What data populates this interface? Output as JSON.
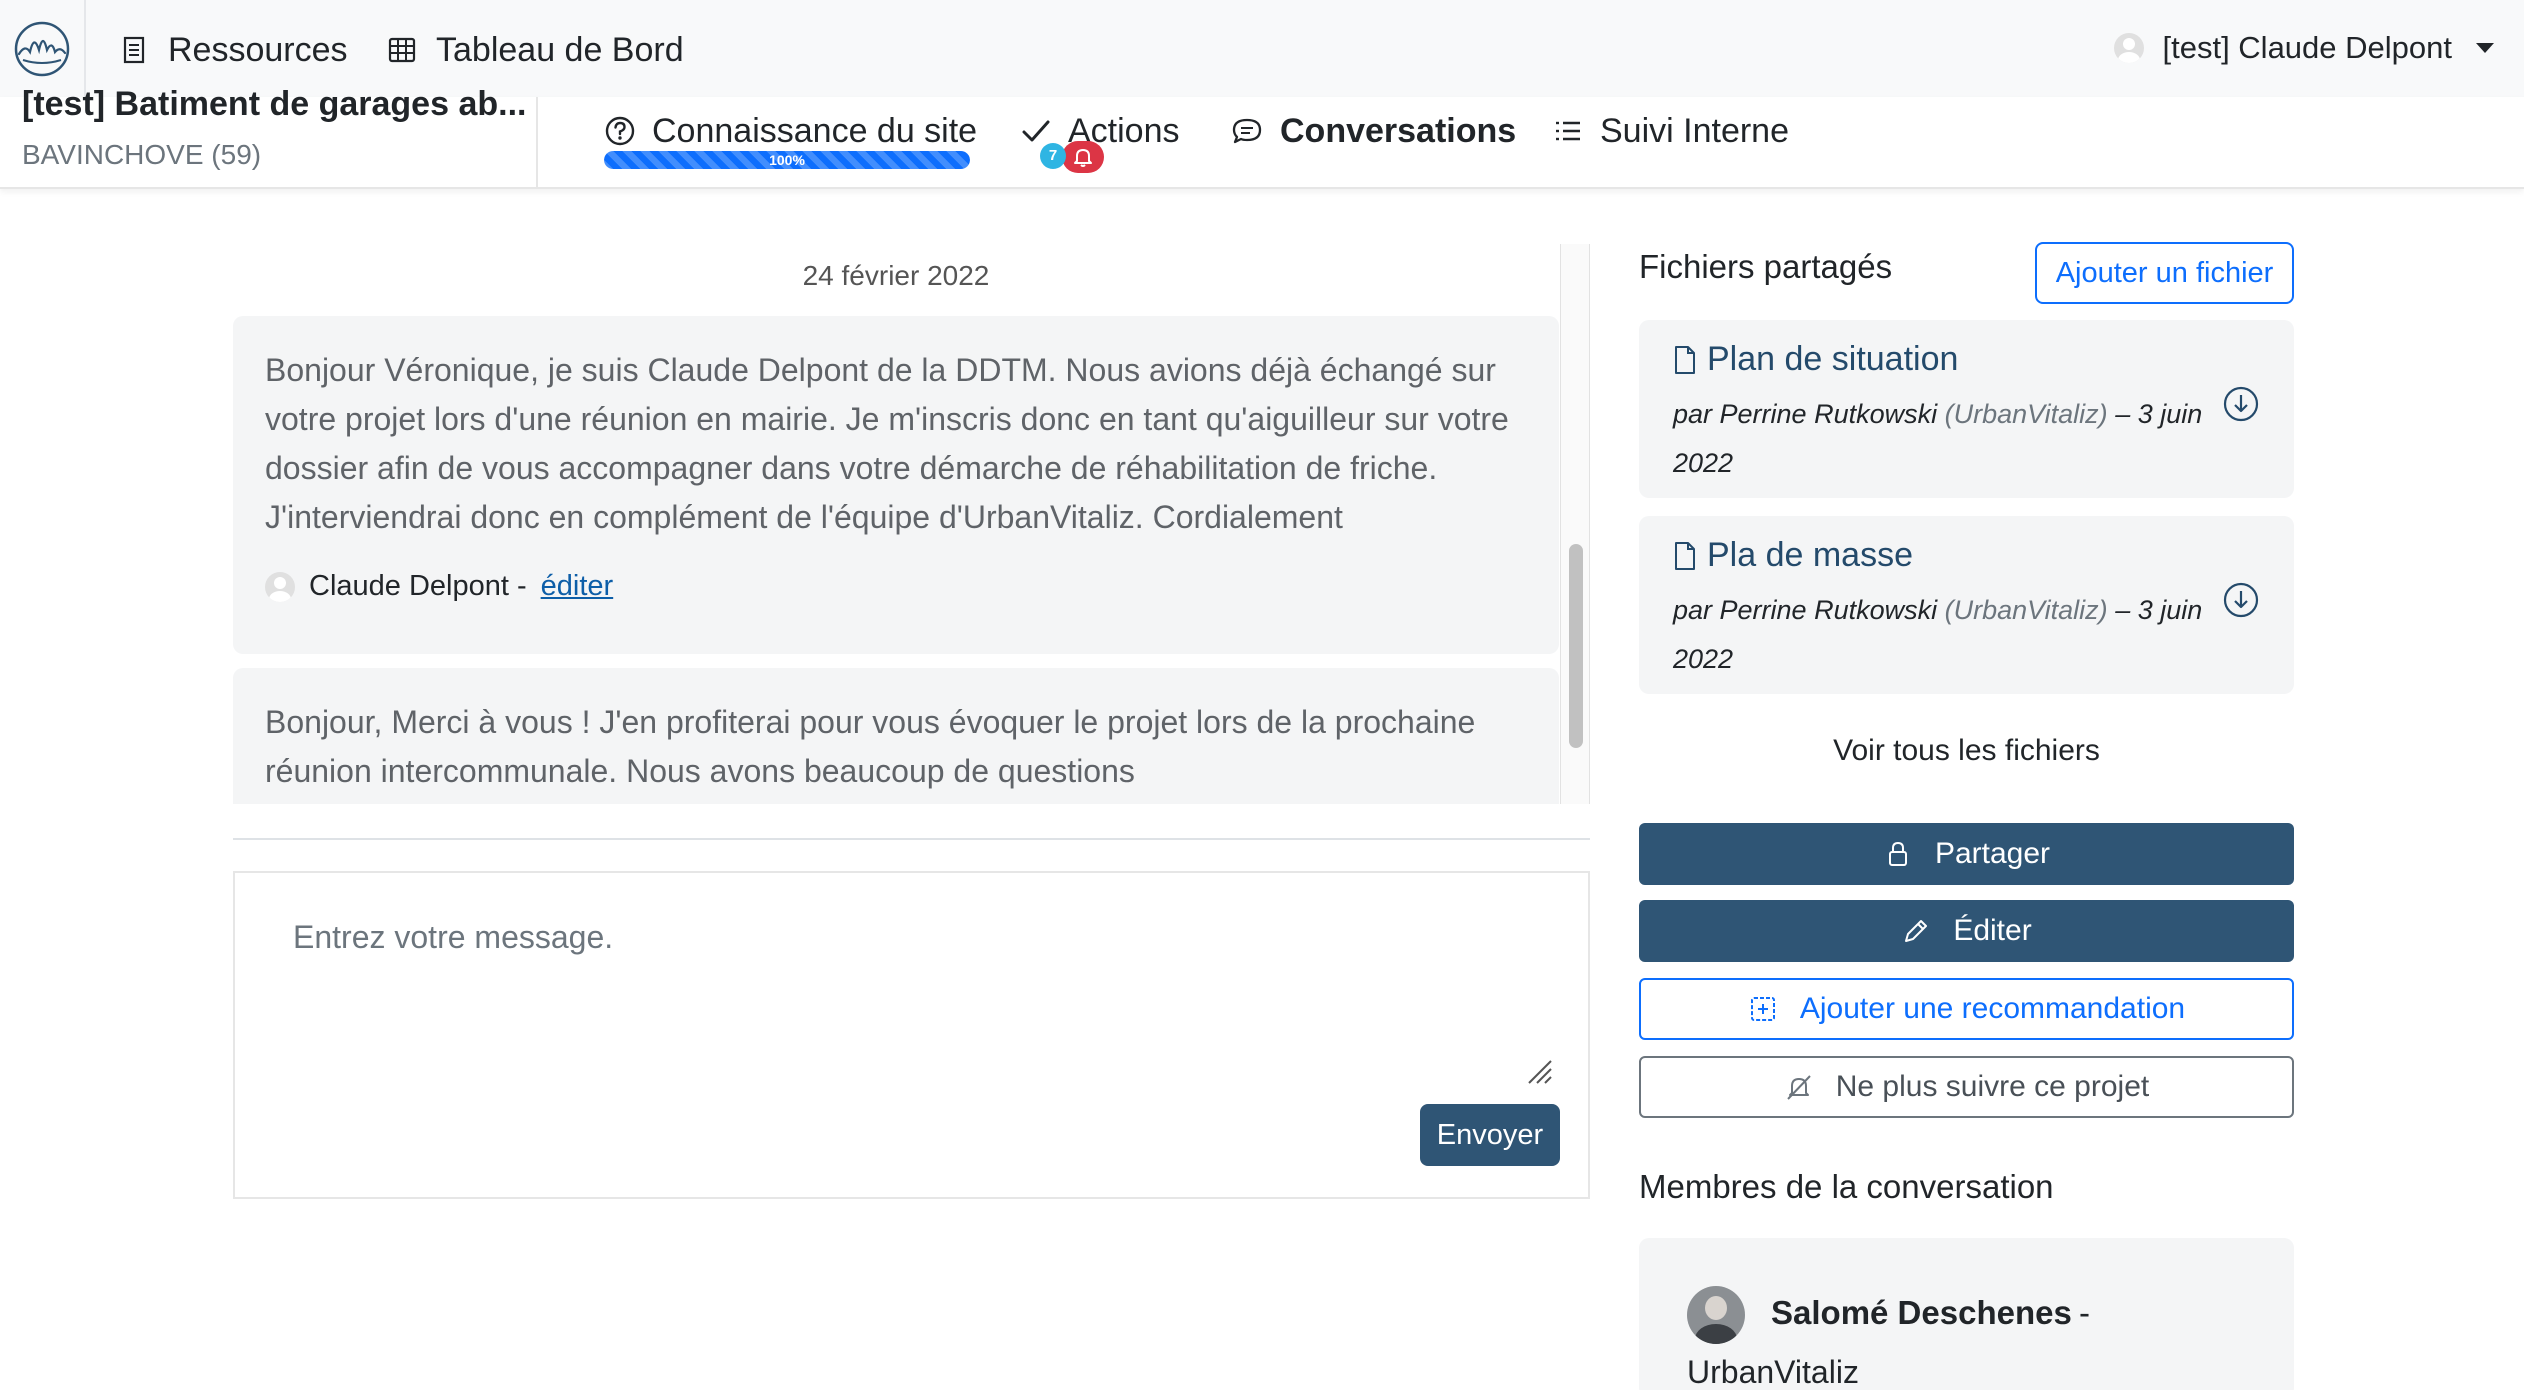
{
  "nav": {
    "resources_label": "Ressources",
    "dashboard_label": "Tableau de Bord",
    "user_label": "[test] Claude Delpont"
  },
  "project": {
    "title": "[test] Batiment de garages ab...",
    "location": "BAVINCHOVE (59)"
  },
  "tabs": {
    "knowledge_label": "Connaissance du site",
    "knowledge_progress_text": "100%",
    "knowledge_progress_value": 100,
    "actions_label": "Actions",
    "actions_badge_count": "7",
    "conversations_label": "Conversations",
    "internal_label": "Suivi Interne"
  },
  "conversation": {
    "date": "24 février 2022",
    "messages": [
      {
        "text": "Bonjour Véronique, je suis Claude Delpont de la DDTM. Nous avions déjà échangé sur votre projet lors d'une réunion en mairie. Je m'inscris donc en tant qu'aiguilleur sur votre dossier afin de vous accompagner dans votre démarche de réhabilitation de friche. J'interviendrai donc en complément de l'équipe d'UrbanVitaliz. Cordialement",
        "author": "Claude Delpont -",
        "edit_label": "éditer"
      },
      {
        "text": "Bonjour, Merci à vous ! J'en profiterai pour vous évoquer le projet lors de la prochaine réunion intercommunale. Nous avons beaucoup de questions"
      }
    ],
    "composer_placeholder": "Entrez votre message.",
    "send_label": "Envoyer"
  },
  "sidebar": {
    "files_title": "Fichiers partagés",
    "add_file_label": "Ajouter un fichier",
    "files": [
      {
        "name": "Plan de situation",
        "by": "par Perrine Rutkowski",
        "org": "(UrbanVitaliz)",
        "date": "– 3 juin 2022"
      },
      {
        "name": "Pla de masse",
        "by": "par Perrine Rutkowski",
        "org": "(UrbanVitaliz)",
        "date": "– 3 juin 2022"
      }
    ],
    "see_all_label": "Voir tous les fichiers",
    "share_label": "Partager",
    "edit_label": "Éditer",
    "add_reco_label": "Ajouter une recommandation",
    "unfollow_label": "Ne plus suivre ce projet",
    "members_title": "Membres de la conversation",
    "members": [
      {
        "name": "Salomé Deschenes",
        "separator": "-",
        "org": "UrbanVitaliz"
      }
    ]
  },
  "colors": {
    "primary": "#0d6efd",
    "dark_button": "#2f5575",
    "danger": "#dc3545",
    "info": "#2fb5e3"
  }
}
